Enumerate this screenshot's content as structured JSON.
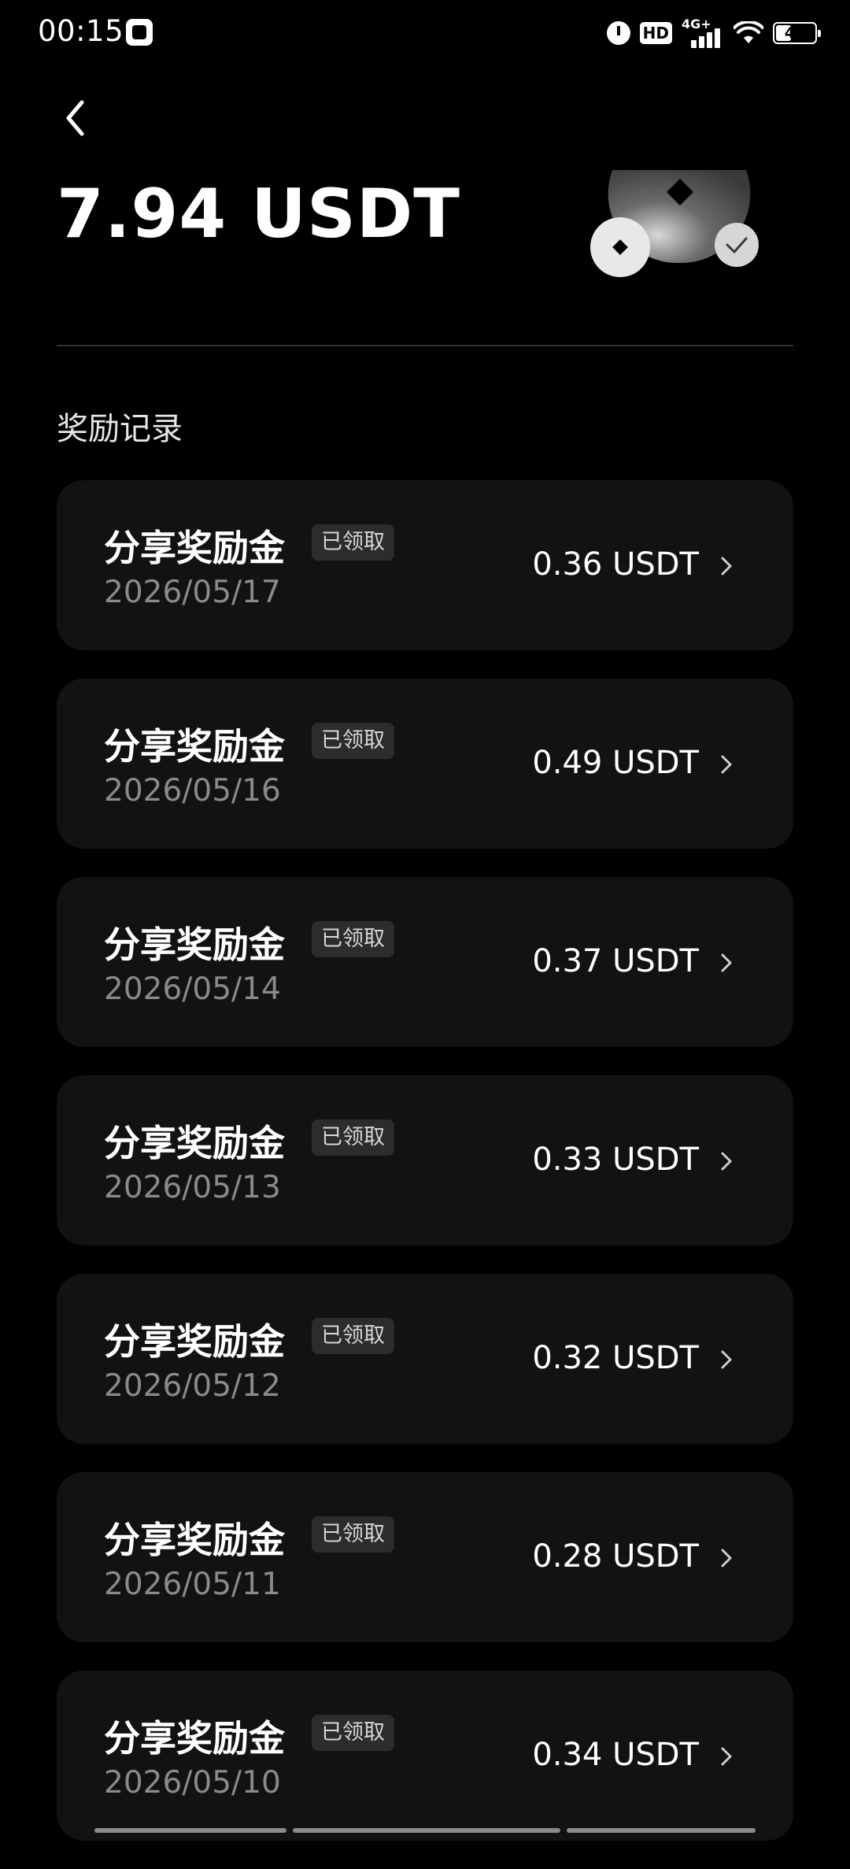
{
  "status_bar": {
    "time": "00:15",
    "app_icon": "gallery-app-icon",
    "alarm_icon": "alarm-icon",
    "hd_label": "HD",
    "network_label": "4G+",
    "signal_level": 1.0,
    "wifi_icon": "wifi-icon",
    "battery_level": "44",
    "battery_fraction": 0.44
  },
  "header": {
    "back_icon": "chevron-left-icon",
    "balance": "7.94 USDT",
    "illustration": "coin-reward-illustration"
  },
  "section": {
    "title": "奖励记录"
  },
  "records": [
    {
      "title": "分享奖励金",
      "status": "已领取",
      "date": "2026/05/17",
      "amount": "0.36 USDT"
    },
    {
      "title": "分享奖励金",
      "status": "已领取",
      "date": "2026/05/16",
      "amount": "0.49 USDT"
    },
    {
      "title": "分享奖励金",
      "status": "已领取",
      "date": "2026/05/14",
      "amount": "0.37 USDT"
    },
    {
      "title": "分享奖励金",
      "status": "已领取",
      "date": "2026/05/13",
      "amount": "0.33 USDT"
    },
    {
      "title": "分享奖励金",
      "status": "已领取",
      "date": "2026/05/12",
      "amount": "0.32 USDT"
    },
    {
      "title": "分享奖励金",
      "status": "已领取",
      "date": "2026/05/11",
      "amount": "0.28 USDT"
    },
    {
      "title": "分享奖励金",
      "status": "已领取",
      "date": "2026/05/10",
      "amount": "0.34 USDT"
    }
  ],
  "colors": {
    "background": "#000000",
    "card": "#121212",
    "badge": "#2c2c2c",
    "muted_text": "#8a8a8a",
    "divider": "#333333"
  }
}
